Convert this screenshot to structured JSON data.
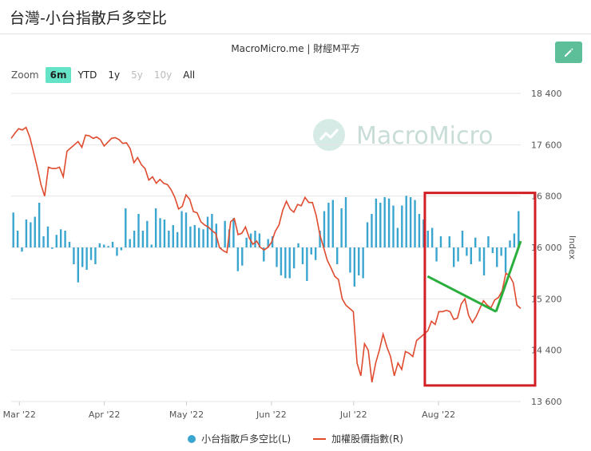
{
  "header": {
    "title": "台灣-小台指散戶多空比"
  },
  "source": "MacroMicro.me | 財經M平方",
  "watermark": "MacroMicro",
  "zoom": {
    "label": "Zoom",
    "buttons": [
      {
        "label": "6m",
        "state": "active"
      },
      {
        "label": "YTD",
        "state": "normal"
      },
      {
        "label": "1y",
        "state": "normal"
      },
      {
        "label": "5y",
        "state": "disabled"
      },
      {
        "label": "10y",
        "state": "disabled"
      },
      {
        "label": "All",
        "state": "normal"
      }
    ]
  },
  "colors": {
    "bars": "#3aa6d0",
    "line": "#e04b2f",
    "highlight_box": "#d21f26",
    "trend_lines": "#2aae3d",
    "accent": "#5cbf9a"
  },
  "chart_data": {
    "type": "bar+line",
    "xaxis": {
      "ticks": [
        "Mar '22",
        "Apr '22",
        "May '22",
        "Jun '22",
        "Jul '22",
        "Aug '22"
      ],
      "range": [
        "2022-02-26",
        "2022-08-31"
      ]
    },
    "yaxis_right": {
      "label": "Index",
      "ticks": [
        "18 400",
        "17 600",
        "16 800",
        "16 000",
        "15 200",
        "14 400",
        "13 600"
      ],
      "range": [
        13600,
        18400
      ]
    },
    "grid": "horizontal",
    "legend_position": "bottom",
    "series": [
      {
        "name": "小台指散戶多空比(L)",
        "type": "bar",
        "axis": "left",
        "values": [
          0.25,
          0.12,
          -0.03,
          0.2,
          0.18,
          0.22,
          0.32,
          0.08,
          0.15,
          -0.01,
          0.09,
          0.13,
          0.12,
          0.04,
          -0.12,
          -0.25,
          -0.14,
          -0.16,
          -0.09,
          -0.12,
          0.03,
          0.02,
          0.01,
          0.04,
          -0.06,
          -0.02,
          0.28,
          0.06,
          0.12,
          0.24,
          0.12,
          0.19,
          0.02,
          0.28,
          0.21,
          0.2,
          0.12,
          0.16,
          0.11,
          0.26,
          0.25,
          0.15,
          0.16,
          0.14,
          0.13,
          0.22,
          0.24,
          0.17,
          -0.01,
          0.19,
          0.13,
          0.21,
          -0.17,
          -0.13,
          0.07,
          0.1,
          0.12,
          0.1,
          -0.1,
          0.06,
          0.08,
          -0.14,
          -0.2,
          -0.22,
          -0.22,
          -0.15,
          0.03,
          -0.12,
          -0.24,
          -0.05,
          -0.09,
          0.12,
          0.26,
          0.32,
          0.34,
          -0.12,
          0.28,
          0.36,
          -0.18,
          -0.28,
          -0.2,
          -0.22,
          0.18,
          0.24,
          0.35,
          0.32,
          0.36,
          0.35,
          0.3,
          0.14,
          0.3,
          0.37,
          0.36,
          0.34,
          0.24,
          0.2,
          0.12,
          0.14,
          -0.1,
          0.08,
          0.0,
          0.08,
          -0.14,
          -0.1,
          0.12,
          -0.06,
          -0.12,
          0.07,
          -0.1,
          -0.2,
          0.08,
          -0.04,
          -0.14,
          -0.06,
          -0.18,
          0.05,
          0.1,
          0.26
        ],
        "unit_note": ""
      },
      {
        "name": "加權股價指數(R)",
        "type": "line",
        "axis": "right",
        "values": [
          17700,
          17780,
          17850,
          17830,
          17870,
          17720,
          17490,
          17250,
          16980,
          16800,
          17250,
          17230,
          17230,
          17250,
          17100,
          17500,
          17550,
          17600,
          17650,
          17560,
          17750,
          17740,
          17700,
          17720,
          17680,
          17580,
          17640,
          17700,
          17710,
          17680,
          17620,
          17630,
          17540,
          17320,
          17400,
          17290,
          17230,
          17050,
          17100,
          17000,
          17060,
          17000,
          16980,
          16900,
          16780,
          16600,
          16640,
          16820,
          16750,
          16560,
          16540,
          16400,
          16350,
          16320,
          16260,
          16220,
          16000,
          15950,
          15920,
          16400,
          16450,
          16200,
          16220,
          16320,
          16150,
          16050,
          16100,
          16000,
          15960,
          16000,
          16080,
          16250,
          16350,
          16580,
          16720,
          16600,
          16550,
          16670,
          16650,
          16780,
          16700,
          16700,
          16500,
          16200,
          16000,
          15800,
          15680,
          15550,
          15500,
          15200,
          15100,
          15050,
          15000,
          14200,
          14000,
          14500,
          14400,
          13900,
          14200,
          14400,
          14650,
          14450,
          14300,
          14000,
          14200,
          14100,
          14380,
          14350,
          14300,
          14550,
          14600,
          14650,
          14700,
          14850,
          14800,
          15000,
          15000,
          15020,
          15000,
          14880,
          14900,
          15120,
          15200,
          14940,
          14830,
          14920,
          15050,
          15170,
          15100,
          15060,
          15180,
          15220,
          15320,
          15600,
          15560,
          15450,
          15100,
          15050
        ]
      }
    ],
    "annotations": [
      {
        "type": "rectangle",
        "x_range": [
          "2022-07-27",
          "2022-08-31"
        ],
        "y_range": [
          13850,
          16850
        ]
      },
      {
        "type": "trend_line",
        "from": [
          "2022-07-28",
          15550
        ],
        "to": [
          "2022-08-22",
          15000
        ]
      },
      {
        "type": "trend_line",
        "from": [
          "2022-08-22",
          15000
        ],
        "to": [
          "2022-08-31",
          15600
        ]
      }
    ]
  },
  "legend": [
    {
      "label": "小台指散戶多空比(L)"
    },
    {
      "label": "加權股價指數(R)"
    }
  ]
}
